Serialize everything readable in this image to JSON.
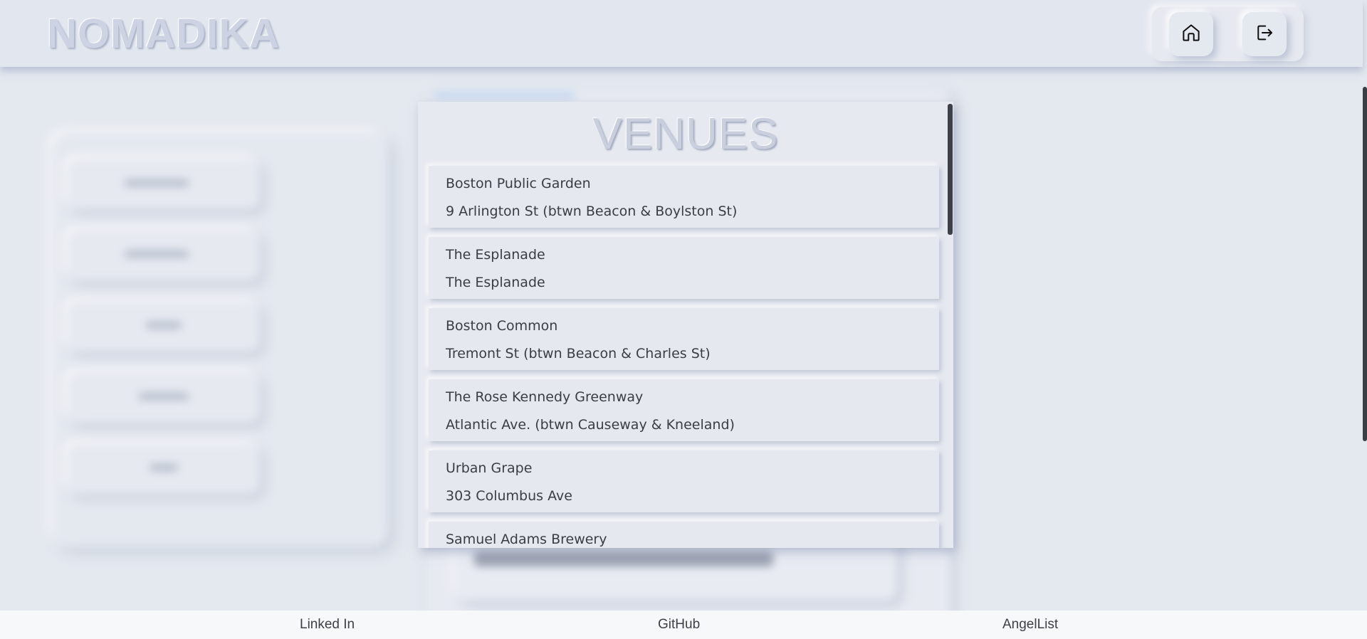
{
  "app": {
    "logo": "NOMADIKA"
  },
  "nav": {
    "home_icon": "home-icon",
    "logout_icon": "logout-icon"
  },
  "venues": {
    "title": "VENUES",
    "items": [
      {
        "name": "Boston Public Garden",
        "address": "9 Arlington St (btwn Beacon & Boylston St)"
      },
      {
        "name": "The Esplanade",
        "address": "The Esplanade"
      },
      {
        "name": "Boston Common",
        "address": "Tremont St (btwn Beacon & Charles St)"
      },
      {
        "name": "The Rose Kennedy Greenway",
        "address": "Atlantic Ave. (btwn Causeway & Kneeland)"
      },
      {
        "name": "Urban Grape",
        "address": "303 Columbus Ave"
      },
      {
        "name": "Samuel Adams Brewery",
        "address": ""
      }
    ]
  },
  "footer": {
    "linkedin": "Linked In",
    "github": "GitHub",
    "angellist": "AngelList"
  },
  "colors": {
    "background": "#e4e8ef",
    "logo": "#cdd3e2",
    "text": "#3a3d44"
  }
}
